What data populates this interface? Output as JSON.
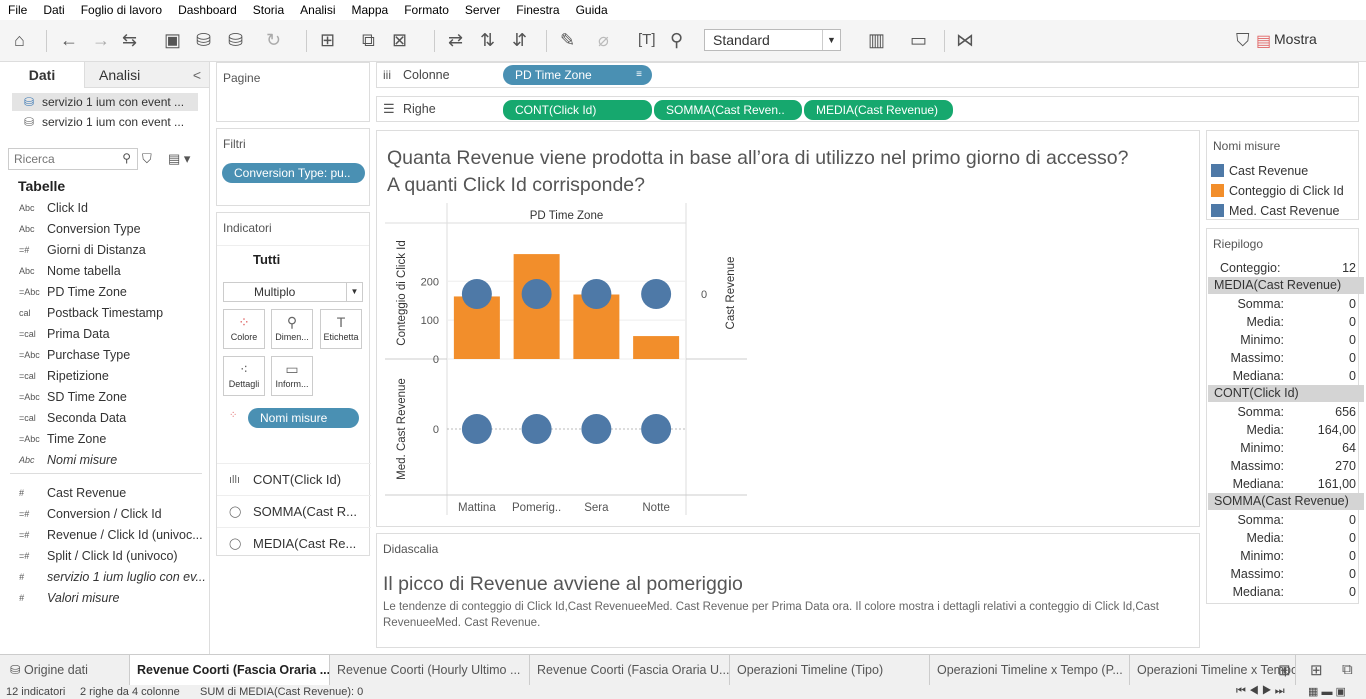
{
  "menu": [
    "File",
    "Dati",
    "Foglio di lavoro",
    "Dashboard",
    "Storia",
    "Analisi",
    "Mappa",
    "Formato",
    "Server",
    "Finestra",
    "Guida"
  ],
  "toolbar": {
    "marks_format": "Standard",
    "show_me": "Mostra"
  },
  "left_panel": {
    "tab_data": "Dati",
    "tab_analytics": "Analisi",
    "datasources": [
      "servizio 1 ium con event ...",
      "servizio 1 ium con event ..."
    ],
    "search_placeholder": "Ricerca",
    "tables_header": "Tabelle",
    "dimensions": [
      {
        "type": "Abc",
        "name": "Click Id"
      },
      {
        "type": "Abc",
        "name": "Conversion Type"
      },
      {
        "type": "=#",
        "name": "Giorni di Distanza"
      },
      {
        "type": "Abc",
        "name": "Nome tabella"
      },
      {
        "type": "=Abc",
        "name": "PD Time Zone"
      },
      {
        "type": "cal",
        "name": "Postback Timestamp"
      },
      {
        "type": "=cal",
        "name": "Prima Data"
      },
      {
        "type": "=Abc",
        "name": "Purchase Type"
      },
      {
        "type": "=cal",
        "name": "Ripetizione"
      },
      {
        "type": "=Abc",
        "name": "SD Time Zone"
      },
      {
        "type": "=cal",
        "name": "Seconda Data"
      },
      {
        "type": "=Abc",
        "name": "Time Zone"
      },
      {
        "type": "Abc",
        "name": "Nomi misure",
        "italic": true
      }
    ],
    "measures": [
      {
        "type": "#",
        "name": "Cast Revenue"
      },
      {
        "type": "=#",
        "name": "Conversion / Click Id"
      },
      {
        "type": "=#",
        "name": "Revenue / Click Id (univoc..."
      },
      {
        "type": "=#",
        "name": "Split / Click Id (univoco)"
      },
      {
        "type": "#",
        "name": "servizio 1 ium luglio con ev...",
        "italic": true
      },
      {
        "type": "#",
        "name": "Valori misure",
        "italic": true
      }
    ]
  },
  "pages_card": {
    "title": "Pagine"
  },
  "filters_card": {
    "title": "Filtri",
    "filter": "Conversion Type: pu.."
  },
  "marks_card": {
    "title": "Indicatori",
    "all": "Tutti",
    "mark_type": "Multiplo",
    "buttons": [
      "Colore",
      "Dimen...",
      "Etichetta",
      "Dettagli",
      "Inform..."
    ],
    "color_pill": "Nomi misure",
    "measures": [
      "CONT(Click Id)",
      "SOMMA(Cast R...",
      "MEDIA(Cast Re..."
    ]
  },
  "shelves": {
    "columns_label": "Colonne",
    "columns_pill": "PD Time Zone",
    "rows_label": "Righe",
    "rows_pills": [
      "CONT(Click Id)",
      "SOMMA(Cast Reven..",
      "MEDIA(Cast Revenue)"
    ]
  },
  "view": {
    "title_line1": "Quanta Revenue viene prodotta in base all’ora di utilizzo nel primo giorno di accesso?",
    "title_line2": "A quanti Click Id corrisponde?"
  },
  "chart_data": {
    "type": "bar",
    "header": "PD Time Zone",
    "categories": [
      "Mattina",
      "Pomerig..",
      "Sera",
      "Notte"
    ],
    "series": [
      {
        "name": "Conteggio di Click Id",
        "kind": "bar",
        "color": "#f28e2b",
        "values": [
          161,
          270,
          166,
          59
        ]
      },
      {
        "name": "Cast Revenue",
        "kind": "circle",
        "color": "#4e79a7",
        "values": [
          0,
          0,
          0,
          0
        ]
      },
      {
        "name": "Med. Cast Revenue",
        "kind": "circle",
        "color": "#4e79a7",
        "values": [
          0,
          0,
          0,
          0
        ]
      }
    ],
    "ylabel_top": "Conteggio di Click Id",
    "ylabel_top_right": "Cast Revenue",
    "ylabel_bottom": "Med. Cast Revenue",
    "yticks_top": [
      "200",
      "100",
      "0"
    ],
    "ytick_right": "0",
    "ytick_bottom": "0",
    "ylim": [
      0,
      300
    ]
  },
  "legend": {
    "title": "Nomi misure",
    "items": [
      {
        "label": "Cast Revenue",
        "color": "#4e79a7"
      },
      {
        "label": "Conteggio di Click Id",
        "color": "#f28e2b"
      },
      {
        "label": "Med. Cast Revenue",
        "color": "#4e79a7"
      }
    ]
  },
  "summary": {
    "title": "Riepilogo",
    "count_label": "Conteggio:",
    "count_value": "12",
    "groups": [
      {
        "header": "MEDIA(Cast Revenue)",
        "rows": [
          [
            "Somma:",
            "0"
          ],
          [
            "Media:",
            "0"
          ],
          [
            "Minimo:",
            "0"
          ],
          [
            "Massimo:",
            "0"
          ],
          [
            "Mediana:",
            "0"
          ]
        ]
      },
      {
        "header": "CONT(Click Id)",
        "rows": [
          [
            "Somma:",
            "656"
          ],
          [
            "Media:",
            "164,00"
          ],
          [
            "Minimo:",
            "64"
          ],
          [
            "Massimo:",
            "270"
          ],
          [
            "Mediana:",
            "161,00"
          ]
        ]
      },
      {
        "header": "SOMMA(Cast Revenue)",
        "rows": [
          [
            "Somma:",
            "0"
          ],
          [
            "Media:",
            "0"
          ],
          [
            "Minimo:",
            "0"
          ],
          [
            "Massimo:",
            "0"
          ],
          [
            "Mediana:",
            "0"
          ]
        ]
      }
    ]
  },
  "caption": {
    "label": "Didascalia",
    "headline": "Il picco di Revenue avviene al pomeriggio",
    "text": "Le tendenze di conteggio di Click Id,Cast RevenueeMed. Cast Revenue per Prima Data ora. Il colore mostra i dettagli relativi a conteggio di Click Id,Cast RevenueeMed. Cast Revenue."
  },
  "tabs": {
    "datasource": "Origine dati",
    "sheets": [
      "Revenue Coorti (Fascia Oraria ...",
      "Revenue Coorti (Hourly Ultimo ...",
      "Revenue Coorti (Fascia Oraria U...",
      "Operazioni Timeline (Tipo)",
      "Operazioni Timeline x Tempo (P...",
      "Operazioni Timeline x Tempo (..."
    ],
    "active_index": 0
  },
  "status": {
    "marks": "12 indicatori",
    "rows_cols": "2 righe da 4 colonne",
    "sum": "SUM di MEDIA(Cast Revenue): 0"
  }
}
